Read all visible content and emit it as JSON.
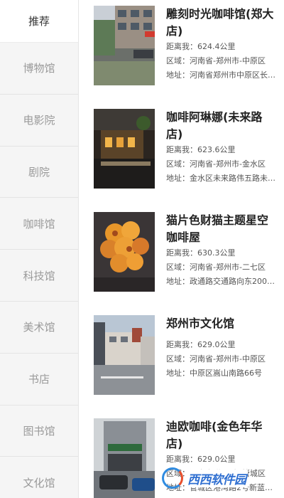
{
  "sidebar": {
    "items": [
      {
        "label": "推荐"
      },
      {
        "label": "博物馆"
      },
      {
        "label": "电影院"
      },
      {
        "label": "剧院"
      },
      {
        "label": "咖啡馆"
      },
      {
        "label": "科技馆"
      },
      {
        "label": "美术馆"
      },
      {
        "label": "书店"
      },
      {
        "label": "图书馆"
      },
      {
        "label": "文化馆"
      }
    ]
  },
  "venues": [
    {
      "name": "雕刻时光咖啡馆(郑大店)",
      "distance": "距离我：624.4公里",
      "region": "区域：河南省-郑州市-中原区",
      "address": "地址：河南省郑州市中原区长…"
    },
    {
      "name": "咖啡阿琳娜(未来路店)",
      "distance": "距离我：623.6公里",
      "region": "区域：河南省-郑州市-金水区",
      "address": "地址：金水区未来路伟五路未…"
    },
    {
      "name": "猫片色财猫主题星空咖啡屋",
      "distance": "距离我：630.3公里",
      "region": "区域：河南省-郑州市-二七区",
      "address": "地址：政通路交通路向东200…"
    },
    {
      "name": "郑州市文化馆",
      "distance": "距离我：629.0公里",
      "region": "区域：河南省-郑州市-中原区",
      "address": "地址：中原区嵩山南路66号"
    },
    {
      "name": "迪欧咖啡(金色年华店)",
      "distance": "距离我：629.0公里",
      "region": "区域：河南省-郑州市-管城区",
      "address": "地址：管城区港湾路2号新蓝钻…"
    }
  ],
  "watermark": {
    "text": "西西软件园"
  },
  "colors": {
    "sidebar_bg": "#f5f5f5",
    "accent": "#2f6fd1",
    "title": "#222222"
  }
}
